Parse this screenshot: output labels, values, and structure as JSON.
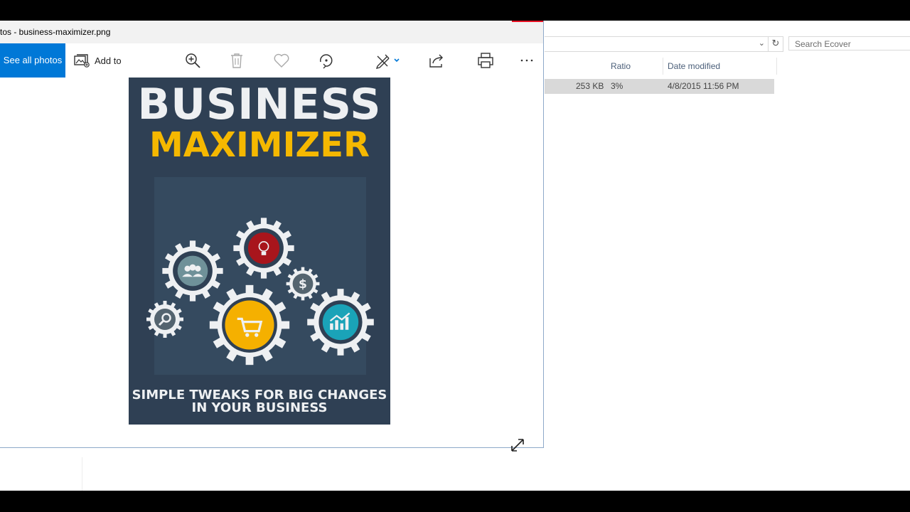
{
  "photos": {
    "title": "tos - business-maximizer.png",
    "toolbar": {
      "see_all_label": "See all photos",
      "add_to_label": "Add to",
      "icons": [
        "zoom-in-icon",
        "trash-icon",
        "heart-icon",
        "rotate-icon",
        "edit-icon",
        "share-icon",
        "print-icon",
        "more-icon"
      ]
    },
    "cover": {
      "title_line1": "BUSINESS",
      "title_line2": "MAXIMIZER",
      "tagline_line1": "SIMPLE TWEAKS FOR BIG CHANGES",
      "tagline_line2": "IN YOUR BUSINESS",
      "dollar_symbol": "$"
    }
  },
  "explorer": {
    "search_placeholder": "Search Ecover",
    "columns": [
      "Ratio",
      "Date modified"
    ],
    "file": {
      "size": "253 KB",
      "ratio": "3%",
      "date_modified": "4/8/2015 11:56 PM"
    }
  },
  "colors": {
    "accent": "#0078d7",
    "cover_bg": "#2f4054",
    "cover_yellow": "#f5b800",
    "gear_red": "#a8151c",
    "gear_teal": "#1aa3b8"
  }
}
